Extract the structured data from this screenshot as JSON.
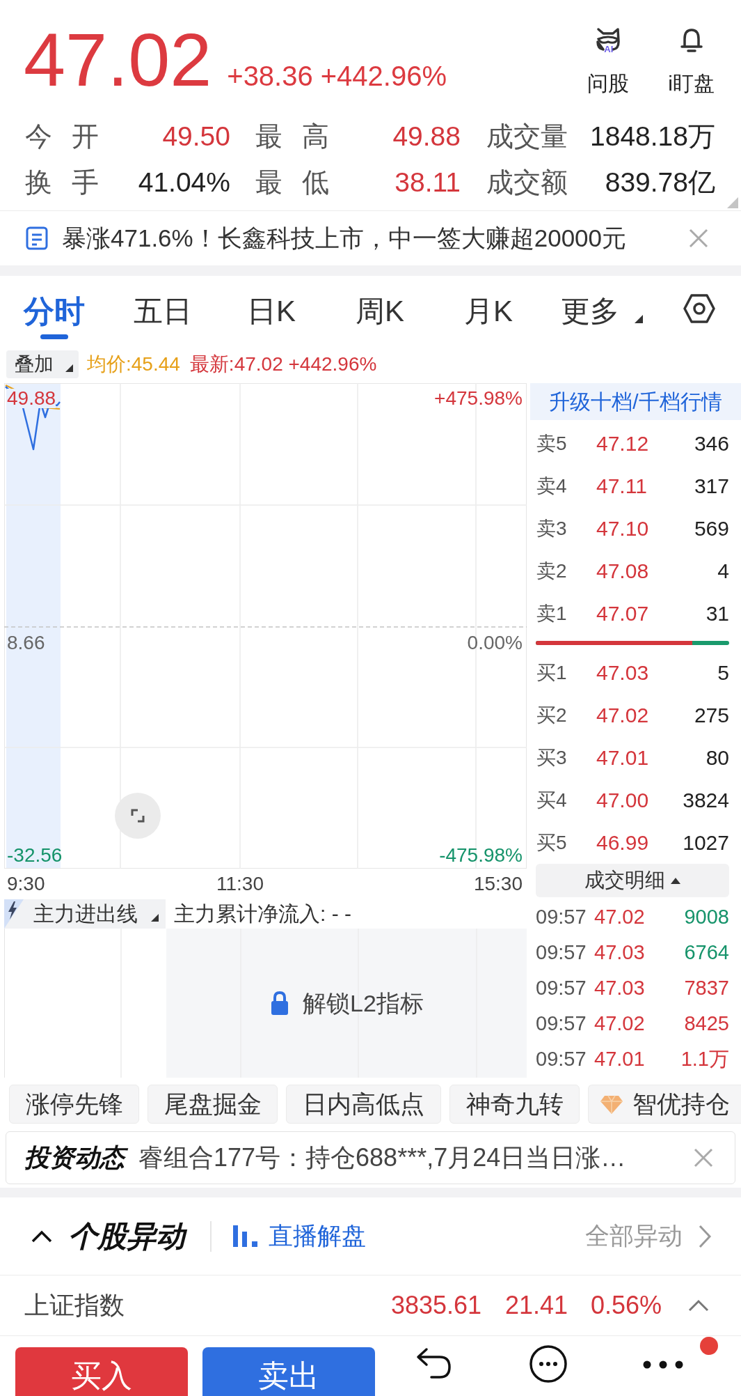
{
  "quote": {
    "price": "47.02",
    "change": "+38.36",
    "change_pct": "+442.96%"
  },
  "actions": [
    {
      "kind": "ai",
      "label": "问股",
      "tag": "AI"
    },
    {
      "kind": "bell",
      "label": "i盯盘"
    }
  ],
  "stats": [
    {
      "label": "今 开",
      "value": "49.50",
      "color": "#d4363c"
    },
    {
      "label": "最 高",
      "value": "49.88",
      "color": "#d4363c"
    },
    {
      "label": "成交量",
      "value": "1848.18万",
      "color": "#222222"
    },
    {
      "label": "换 手",
      "value": "41.04%",
      "color": "#222222"
    },
    {
      "label": "最 低",
      "value": "38.11",
      "color": "#d4363c"
    },
    {
      "label": "成交额",
      "value": "839.78亿",
      "color": "#222222"
    }
  ],
  "news_banner": {
    "text": "暴涨471.6%！长鑫科技上市，中一签大赚超20000元"
  },
  "tabs": [
    {
      "label": "分时",
      "selected": true,
      "kind": "tab"
    },
    {
      "label": "五日",
      "selected": false,
      "kind": "tab"
    },
    {
      "label": "日K",
      "selected": false,
      "kind": "tab"
    },
    {
      "label": "周K",
      "selected": false,
      "kind": "tab"
    },
    {
      "label": "月K",
      "selected": false,
      "kind": "tab"
    },
    {
      "label": "更多",
      "selected": false,
      "kind": "menu"
    }
  ],
  "chart_legend": {
    "overlay": "叠加",
    "average": "均价:45.44",
    "latest": "最新:47.02 +442.96%"
  },
  "chart": {
    "price_labels": [
      "49.88",
      "8.66",
      "-32.56"
    ],
    "percent_labels": [
      "+475.98%",
      "0.00%",
      "-475.98%"
    ],
    "time_labels": [
      "9:30",
      "11:30",
      "15:30"
    ]
  },
  "order_book": {
    "header": "升级十档/千档行情",
    "asks": [
      {
        "label": "卖5",
        "price": "47.12",
        "volume": "346"
      },
      {
        "label": "卖4",
        "price": "47.11",
        "volume": "317"
      },
      {
        "label": "卖3",
        "price": "47.10",
        "volume": "569"
      },
      {
        "label": "卖2",
        "price": "47.08",
        "volume": "4"
      },
      {
        "label": "卖1",
        "price": "47.07",
        "volume": "31"
      }
    ],
    "ratio": {
      "level": 0.81
    },
    "bids": [
      {
        "label": "买1",
        "price": "47.03",
        "volume": "5"
      },
      {
        "label": "买2",
        "price": "47.02",
        "volume": "275"
      },
      {
        "label": "买3",
        "price": "47.01",
        "volume": "80"
      },
      {
        "label": "买4",
        "price": "47.00",
        "volume": "3824"
      },
      {
        "label": "买5",
        "price": "46.99",
        "volume": "1027"
      }
    ]
  },
  "trades": {
    "header": "成交明细",
    "rows": [
      {
        "time": "09:57",
        "price": "47.02",
        "volume": "9008",
        "color": "#15936a"
      },
      {
        "time": "09:57",
        "price": "47.03",
        "volume": "6764",
        "color": "#15936a"
      },
      {
        "time": "09:57",
        "price": "47.03",
        "volume": "7837",
        "color": "#d4363c"
      },
      {
        "time": "09:57",
        "price": "47.02",
        "volume": "8425",
        "color": "#d4363c"
      },
      {
        "time": "09:57",
        "price": "47.01",
        "volume": "1.1万",
        "color": "#d4363c"
      }
    ]
  },
  "indicator": {
    "name": "主力进出线",
    "summary": "主力累计净流入: - -",
    "lock": "解锁L2指标"
  },
  "chips": [
    {
      "label": "涨停先锋",
      "kind": "plain"
    },
    {
      "label": "尾盘掘金",
      "kind": "plain"
    },
    {
      "label": "日内高低点",
      "kind": "plain"
    },
    {
      "label": "神奇九转",
      "kind": "plain"
    },
    {
      "label": "智优持仓",
      "kind": "diamond"
    }
  ],
  "invest_news": {
    "title": "投资动态",
    "text": "睿组合177号：持仓688***,7月24日当日涨…"
  },
  "movers": {
    "title": "个股异动",
    "live": "直播解盘",
    "all": "全部异动"
  },
  "index": {
    "name": "上证指数",
    "value": "3835.61",
    "change": "21.41",
    "change_pct": "0.56%"
  },
  "trade_buttons": [
    {
      "label": "买入",
      "kind": "buy"
    },
    {
      "label": "卖出",
      "kind": "sell"
    }
  ],
  "toolbar": [
    {
      "kind": "undo",
      "badge": false
    },
    {
      "kind": "chat",
      "badge": false
    },
    {
      "kind": "more",
      "badge": true
    }
  ]
}
